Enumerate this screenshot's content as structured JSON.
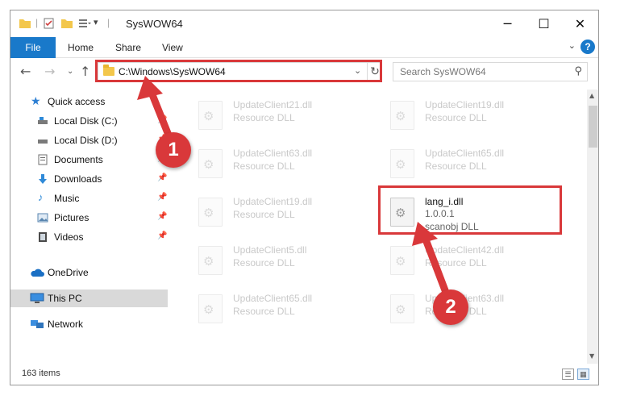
{
  "window": {
    "title": "SysWOW64"
  },
  "ribbon": {
    "file_tab": "File",
    "tabs": [
      "Home",
      "Share",
      "View"
    ],
    "help": "?"
  },
  "nav": {
    "address": "C:\\Windows\\SysWOW64",
    "search_placeholder": "Search SysWOW64"
  },
  "sidebar": {
    "items": [
      {
        "label": "Quick access",
        "icon": "star-icon",
        "pinned": false
      },
      {
        "label": "Local Disk (C:)",
        "icon": "drive-icon",
        "pinned": true
      },
      {
        "label": "Local Disk (D:)",
        "icon": "drive-icon",
        "pinned": true
      },
      {
        "label": "Documents",
        "icon": "documents-icon",
        "pinned": true
      },
      {
        "label": "Downloads",
        "icon": "downloads-icon",
        "pinned": true
      },
      {
        "label": "Music",
        "icon": "music-icon",
        "pinned": true
      },
      {
        "label": "Pictures",
        "icon": "pictures-icon",
        "pinned": true
      },
      {
        "label": "Videos",
        "icon": "videos-icon",
        "pinned": true
      },
      {
        "label": "OneDrive",
        "icon": "cloud-icon",
        "pinned": false
      },
      {
        "label": "This PC",
        "icon": "pc-icon",
        "pinned": false,
        "selected": true
      },
      {
        "label": "Network",
        "icon": "network-icon",
        "pinned": false
      }
    ]
  },
  "files": [
    {
      "name": "UpdateClient21.dll",
      "type": "Resource DLL",
      "faded": true
    },
    {
      "name": "UpdateClient19.dll",
      "type": "Resource DLL",
      "faded": true
    },
    {
      "name": "UpdateClient63.dll",
      "type": "Resource DLL",
      "faded": true
    },
    {
      "name": "UpdateClient65.dll",
      "type": "Resource DLL",
      "faded": true
    },
    {
      "name": "UpdateClient19.dll",
      "type": "Resource DLL",
      "faded": true
    },
    {
      "name": "lang_i.dll",
      "version": "1.0.0.1",
      "type": "scanobj DLL",
      "faded": false
    },
    {
      "name": "UpdateClient5.dll",
      "type": "Resource DLL",
      "faded": true
    },
    {
      "name": "UpdateClient42.dll",
      "type": "Resource DLL",
      "faded": true
    },
    {
      "name": "UpdateClient65.dll",
      "type": "Resource DLL",
      "faded": true
    },
    {
      "name": "UpdateClient63.dll",
      "type": "Resource DLL",
      "faded": true
    }
  ],
  "status": {
    "item_count": "163 items"
  },
  "annotations": {
    "step1": "1",
    "step2": "2",
    "accent": "#d9383a"
  }
}
